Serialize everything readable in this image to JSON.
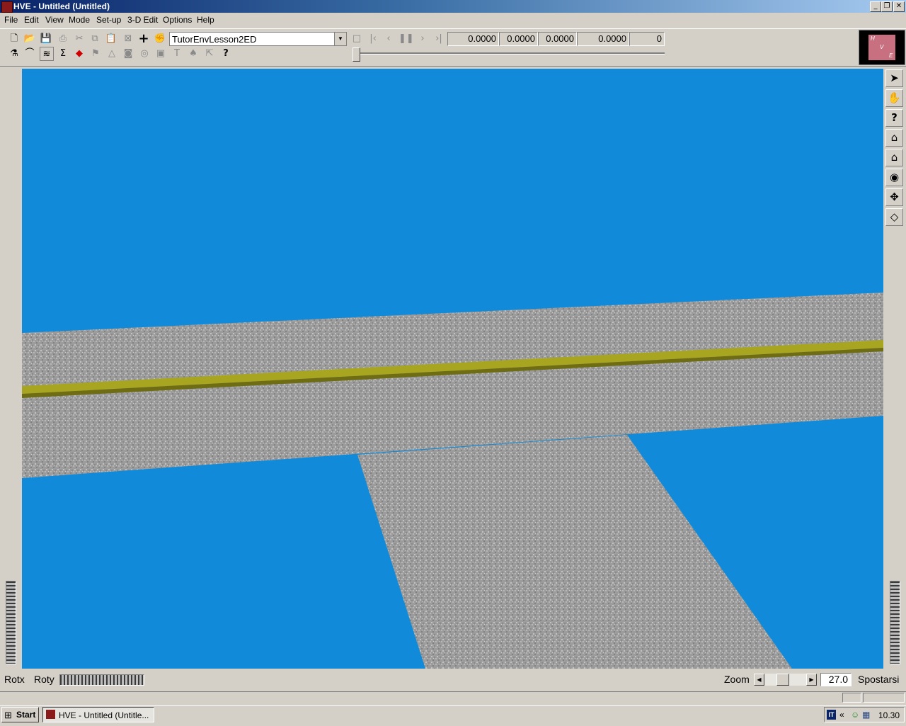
{
  "window": {
    "title": "HVE - Untitled (Untitled)"
  },
  "menu": [
    "File",
    "Edit",
    "View",
    "Mode",
    "Set-up",
    "3-D Edit",
    "Options",
    "Help"
  ],
  "toolbar": {
    "environment_select": "TutorEnvLesson2ED",
    "readouts": [
      "0.0000",
      "0.0000",
      "0.0000",
      "0.0000",
      "0"
    ],
    "playback_position": 0
  },
  "logo": {
    "letters": [
      "H",
      "V",
      "E"
    ]
  },
  "right_tools": [
    "select-arrow",
    "hand",
    "help",
    "home",
    "home-set",
    "eye",
    "move-cross",
    "cube-perspective"
  ],
  "bottom": {
    "rotx_label": "Rotx",
    "roty_label": "Roty",
    "zoom_label": "Zoom",
    "zoom_value": "27.0",
    "mode_label": "Spostarsi"
  },
  "taskbar": {
    "start_label": "Start",
    "task_label": "HVE - Untitled (Untitle...",
    "tray_lang": "IT",
    "clock": "10.30"
  },
  "colors": {
    "viewport_background": "#108ad9",
    "road": "#9a9a9a",
    "center_line": "#a8a620"
  }
}
